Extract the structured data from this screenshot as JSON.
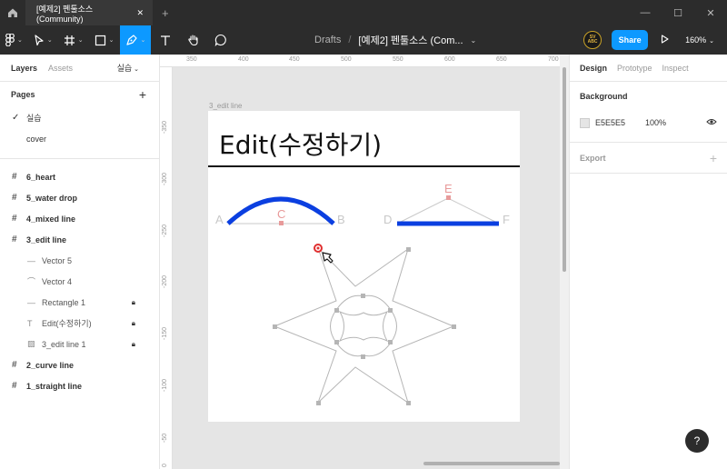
{
  "titlebar": {
    "tab_title": "[예제2] 펜툴소스 (Community)",
    "tab_close": "✕",
    "tab_add": "+",
    "win_min": "—",
    "win_max": "☐",
    "win_close": "✕"
  },
  "toolbar": {
    "crumb_drafts": "Drafts",
    "crumb_sep": "/",
    "file_name": "[예제2] 펜툴소스 (Com...",
    "avatar_text": "SV ABC",
    "share_label": "Share",
    "zoom": "160%",
    "chev": "⌄"
  },
  "left_panel": {
    "tab_layers": "Layers",
    "tab_assets": "Assets",
    "current_page": "실습",
    "pages_label": "Pages",
    "pages": [
      {
        "label": "실습",
        "checked": true
      },
      {
        "label": "cover",
        "checked": false
      }
    ],
    "layers": [
      {
        "label": "6_heart",
        "type": "frame"
      },
      {
        "label": "5_water drop",
        "type": "frame"
      },
      {
        "label": "4_mixed line",
        "type": "frame"
      },
      {
        "label": "3_edit line",
        "type": "frame"
      },
      {
        "label": "Vector 5",
        "type": "vector-line",
        "locked": false
      },
      {
        "label": "Vector 4",
        "type": "vector-curve",
        "locked": false
      },
      {
        "label": "Rectangle 1",
        "type": "rectangle",
        "locked": true
      },
      {
        "label": "Edit(수정하기)",
        "type": "text",
        "locked": true
      },
      {
        "label": "3_edit line 1",
        "type": "image",
        "locked": true
      },
      {
        "label": "2_curve line",
        "type": "frame"
      },
      {
        "label": "1_straight line",
        "type": "frame"
      }
    ]
  },
  "canvas": {
    "ruler_top": [
      "350",
      "400",
      "450",
      "500",
      "550",
      "600",
      "650",
      "700"
    ],
    "ruler_left": [
      "-350",
      "-300",
      "-250",
      "-200",
      "-150",
      "-100",
      "-50",
      "0"
    ],
    "frame_label": "3_edit line",
    "frame_title": "Edit(수정하기)",
    "point_labels": {
      "a": "A",
      "b": "B",
      "c": "C",
      "d": "D",
      "e": "E",
      "f": "F"
    },
    "colors": {
      "accent_blue": "#0b3fe0",
      "handle_pink": "#e89a9a",
      "guide_gray": "#b5b5b5",
      "label_gray": "#c8c8c8"
    }
  },
  "right_panel": {
    "tab_design": "Design",
    "tab_prototype": "Prototype",
    "tab_inspect": "Inspect",
    "background_label": "Background",
    "bg_hex": "E5E5E5",
    "bg_opacity": "100%",
    "export_label": "Export",
    "export_plus": "+"
  },
  "help_label": "?"
}
